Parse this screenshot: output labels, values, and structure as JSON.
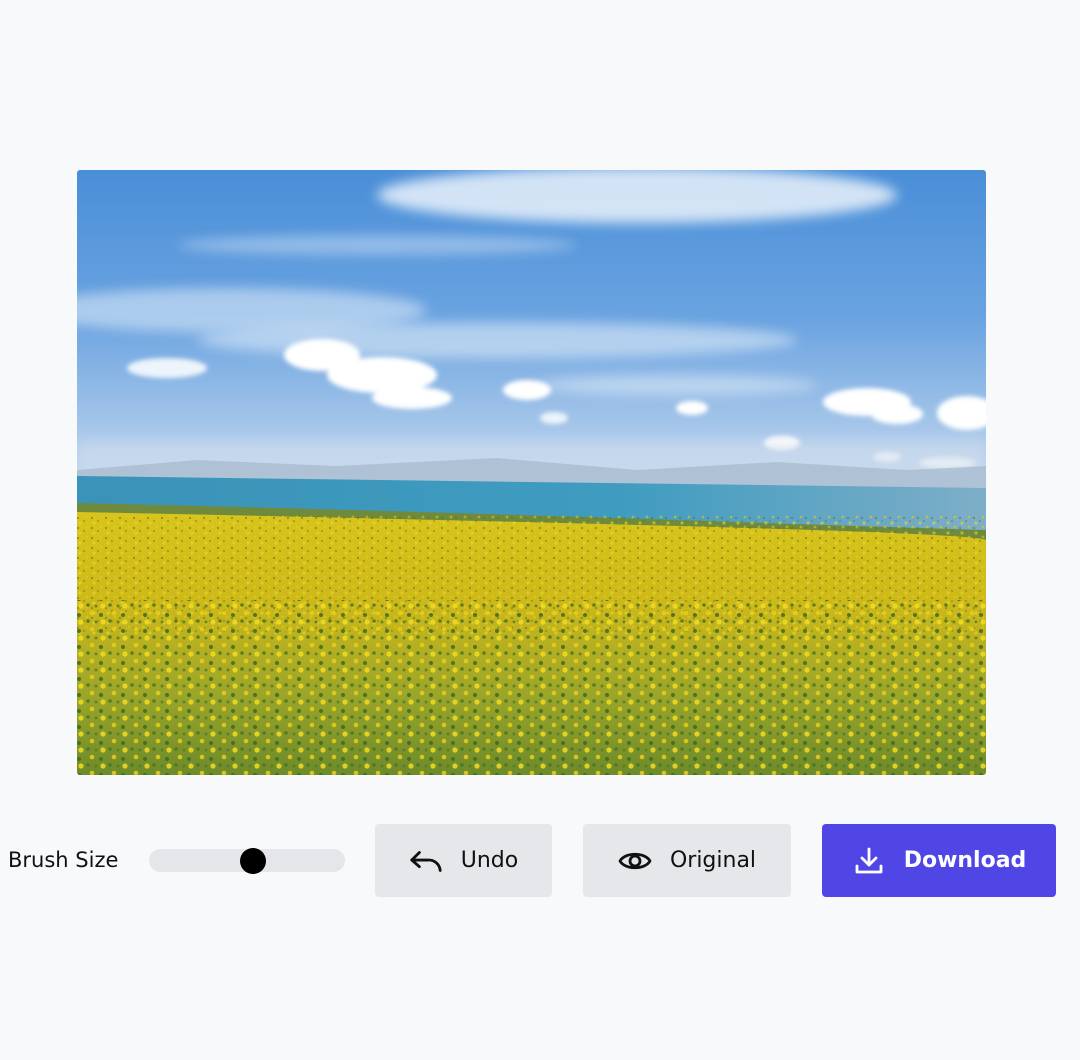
{
  "editor": {
    "image_description_icon": "landscape-photo",
    "brush": {
      "label": "Brush Size",
      "value_fraction": 0.53
    },
    "buttons": {
      "undo_label": "Undo",
      "undo_icon": "undo-arrow-icon",
      "original_label": "Original",
      "original_icon": "eye-icon",
      "download_label": "Download",
      "download_icon": "download-icon"
    },
    "colors": {
      "background": "#f8f9fb",
      "secondary_button": "#e5e7eb",
      "primary_button": "#4f46e5",
      "slider_track": "#e4e6ea",
      "slider_thumb": "#000000"
    }
  }
}
